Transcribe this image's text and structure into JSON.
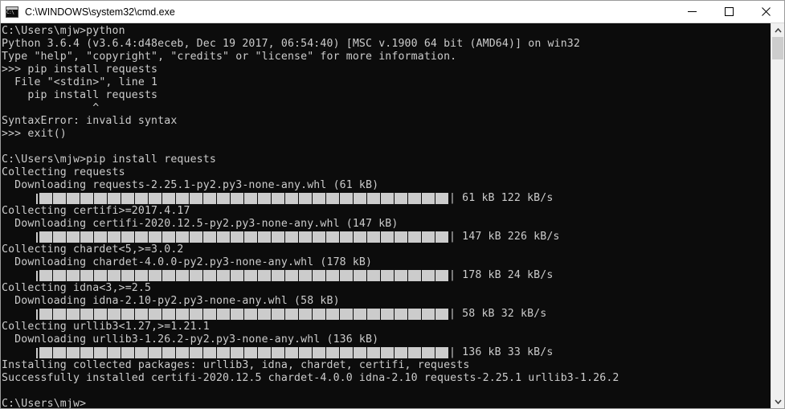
{
  "window": {
    "title": "C:\\WINDOWS\\system32\\cmd.exe",
    "icon": "cmd-console-icon",
    "icon_text": "C:\\",
    "titlebar_bg": "#ffffff",
    "console_bg": "#0c0c0c",
    "console_fg": "#cccccc",
    "controls": {
      "minimize": "minimize-button",
      "maximize": "maximize-button",
      "close": "close-button"
    }
  },
  "scrollbar": {
    "up_arrow": "scroll-up-arrow",
    "down_arrow": "scroll-down-arrow",
    "thumb": "scrollbar-thumb"
  },
  "console": {
    "lines": [
      {
        "type": "text",
        "text": "C:\\Users\\mjw>python"
      },
      {
        "type": "text",
        "text": "Python 3.6.4 (v3.6.4:d48eceb, Dec 19 2017, 06:54:40) [MSC v.1900 64 bit (AMD64)] on win32"
      },
      {
        "type": "text",
        "text": "Type \"help\", \"copyright\", \"credits\" or \"license\" for more information."
      },
      {
        "type": "text",
        "text": ">>> pip install requests"
      },
      {
        "type": "text",
        "text": "  File \"<stdin>\", line 1"
      },
      {
        "type": "text",
        "text": "    pip install requests"
      },
      {
        "type": "text",
        "text": "              ^"
      },
      {
        "type": "text",
        "text": "SyntaxError: invalid syntax"
      },
      {
        "type": "text",
        "text": ">>> exit()"
      },
      {
        "type": "blank",
        "text": " "
      },
      {
        "type": "text",
        "text": "C:\\Users\\mjw>pip install requests"
      },
      {
        "type": "text",
        "text": "Collecting requests"
      },
      {
        "type": "text",
        "text": "  Downloading requests-2.25.1-py2.py3-none-any.whl (61 kB)"
      },
      {
        "type": "progress",
        "blocks": 30,
        "status": "| 61 kB 122 kB/s"
      },
      {
        "type": "text",
        "text": "Collecting certifi>=2017.4.17"
      },
      {
        "type": "text",
        "text": "  Downloading certifi-2020.12.5-py2.py3-none-any.whl (147 kB)"
      },
      {
        "type": "progress",
        "blocks": 30,
        "status": "| 147 kB 226 kB/s"
      },
      {
        "type": "text",
        "text": "Collecting chardet<5,>=3.0.2"
      },
      {
        "type": "text",
        "text": "  Downloading chardet-4.0.0-py2.py3-none-any.whl (178 kB)"
      },
      {
        "type": "progress",
        "blocks": 30,
        "status": "| 178 kB 24 kB/s"
      },
      {
        "type": "text",
        "text": "Collecting idna<3,>=2.5"
      },
      {
        "type": "text",
        "text": "  Downloading idna-2.10-py2.py3-none-any.whl (58 kB)"
      },
      {
        "type": "progress",
        "blocks": 30,
        "status": "| 58 kB 32 kB/s"
      },
      {
        "type": "text",
        "text": "Collecting urllib3<1.27,>=1.21.1"
      },
      {
        "type": "text",
        "text": "  Downloading urllib3-1.26.2-py2.py3-none-any.whl (136 kB)"
      },
      {
        "type": "progress",
        "blocks": 30,
        "status": "| 136 kB 33 kB/s"
      },
      {
        "type": "text",
        "text": "Installing collected packages: urllib3, idna, chardet, certifi, requests"
      },
      {
        "type": "text",
        "text": "Successfully installed certifi-2020.12.5 chardet-4.0.0 idna-2.10 requests-2.25.1 urllib3-1.26.2"
      },
      {
        "type": "blank",
        "text": " "
      },
      {
        "type": "text",
        "text": "C:\\Users\\mjw>"
      }
    ]
  }
}
